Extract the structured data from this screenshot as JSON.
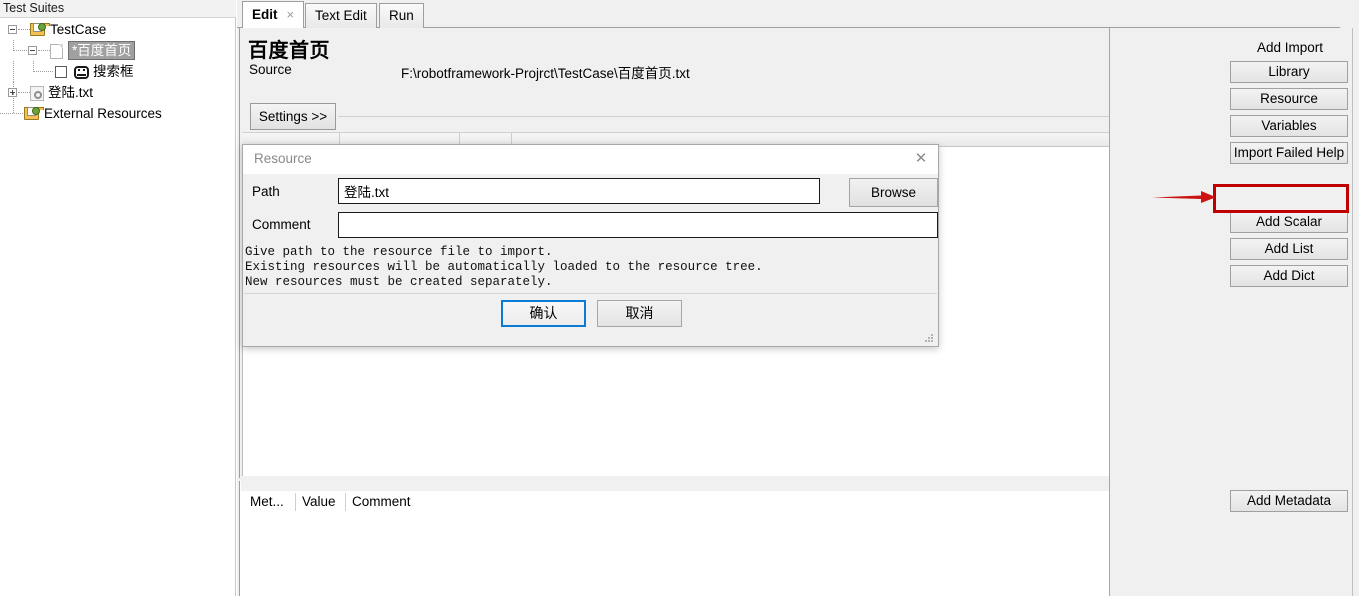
{
  "left_pane": {
    "header": "Test Suites",
    "tree": [
      {
        "label": "TestCase",
        "icon": "suite-folder-icon",
        "expander": "minus",
        "selected": false
      },
      {
        "label": "*百度首页",
        "icon": "file-icon",
        "expander": "minus",
        "selected": true
      },
      {
        "label": "搜索框",
        "icon": "robot-face-icon",
        "expander": "none",
        "checkbox": true,
        "selected": false
      },
      {
        "label": "登陆.txt",
        "icon": "resource-txt-icon",
        "expander": "plus",
        "selected": false
      },
      {
        "label": "External Resources",
        "icon": "suite-folder-icon",
        "expander": "none",
        "selected": false
      }
    ]
  },
  "tabs": [
    {
      "label": "Edit",
      "active": true,
      "closable": true,
      "close_glyph": "×"
    },
    {
      "label": "Text Edit",
      "active": false,
      "closable": false
    },
    {
      "label": "Run",
      "active": false,
      "closable": false
    }
  ],
  "editor": {
    "title": "百度首页",
    "source_label": "Source",
    "source_value": "F:\\robotframework-Projrct\\TestCase\\百度首页.txt",
    "settings_button": "Settings >>"
  },
  "metadata_table": {
    "columns": [
      "Met...",
      "Value",
      "Comment"
    ],
    "rows": []
  },
  "right_bar": {
    "add_import_title": "Add Import",
    "import_buttons": [
      "Library",
      "Resource",
      "Variables",
      "Import Failed Help"
    ],
    "variable_buttons": [
      "Add Scalar",
      "Add List",
      "Add Dict"
    ],
    "metadata_button": "Add Metadata",
    "highlight_target": "Resource",
    "highlight_color": "#c00000",
    "arrow_color": "#cc1111"
  },
  "dialog": {
    "title": "Resource",
    "close_glyph": "✕",
    "path_label": "Path",
    "path_value": "登陆.txt",
    "path_placeholder": "",
    "comment_label": "Comment",
    "comment_value": "",
    "comment_placeholder": "",
    "browse_button": "Browse",
    "help_text": "Give path to the resource file to import.\nExisting resources will be automatically loaded to the resource tree.\nNew resources must be created separately.",
    "ok_button": "确认",
    "cancel_button": "取消",
    "focus_color": "#0a7bd4"
  }
}
